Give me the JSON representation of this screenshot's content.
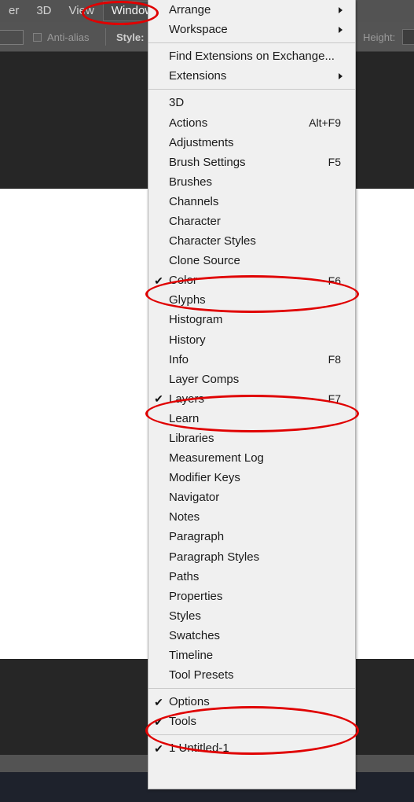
{
  "app": {
    "menubar": [
      {
        "label": "er",
        "active": false
      },
      {
        "label": "3D",
        "active": false
      },
      {
        "label": "View",
        "active": false
      },
      {
        "label": "Window",
        "active": true
      }
    ],
    "options_bar": {
      "antialias_label": "Anti-alias",
      "style_label": "Style:",
      "height_label": "Height:"
    }
  },
  "menu": {
    "title": "Window",
    "groups": [
      {
        "name": "arrange-group",
        "items": [
          {
            "label": "Arrange",
            "shortcut": "",
            "checked": false,
            "submenu": true
          },
          {
            "label": "Workspace",
            "shortcut": "",
            "checked": false,
            "submenu": true
          }
        ]
      },
      {
        "name": "extensions-group",
        "items": [
          {
            "label": "Find Extensions on Exchange...",
            "shortcut": "",
            "checked": false,
            "submenu": false
          },
          {
            "label": "Extensions",
            "shortcut": "",
            "checked": false,
            "submenu": true
          }
        ]
      },
      {
        "name": "panels-group",
        "items": [
          {
            "label": "3D",
            "shortcut": "",
            "checked": false,
            "submenu": false
          },
          {
            "label": "Actions",
            "shortcut": "Alt+F9",
            "checked": false,
            "submenu": false
          },
          {
            "label": "Adjustments",
            "shortcut": "",
            "checked": false,
            "submenu": false
          },
          {
            "label": "Brush Settings",
            "shortcut": "F5",
            "checked": false,
            "submenu": false
          },
          {
            "label": "Brushes",
            "shortcut": "",
            "checked": false,
            "submenu": false
          },
          {
            "label": "Channels",
            "shortcut": "",
            "checked": false,
            "submenu": false
          },
          {
            "label": "Character",
            "shortcut": "",
            "checked": false,
            "submenu": false
          },
          {
            "label": "Character Styles",
            "shortcut": "",
            "checked": false,
            "submenu": false
          },
          {
            "label": "Clone Source",
            "shortcut": "",
            "checked": false,
            "submenu": false
          },
          {
            "label": "Color",
            "shortcut": "F6",
            "checked": true,
            "submenu": false
          },
          {
            "label": "Glyphs",
            "shortcut": "",
            "checked": false,
            "submenu": false
          },
          {
            "label": "Histogram",
            "shortcut": "",
            "checked": false,
            "submenu": false
          },
          {
            "label": "History",
            "shortcut": "",
            "checked": false,
            "submenu": false
          },
          {
            "label": "Info",
            "shortcut": "F8",
            "checked": false,
            "submenu": false
          },
          {
            "label": "Layer Comps",
            "shortcut": "",
            "checked": false,
            "submenu": false
          },
          {
            "label": "Layers",
            "shortcut": "F7",
            "checked": true,
            "submenu": false
          },
          {
            "label": "Learn",
            "shortcut": "",
            "checked": false,
            "submenu": false
          },
          {
            "label": "Libraries",
            "shortcut": "",
            "checked": false,
            "submenu": false
          },
          {
            "label": "Measurement Log",
            "shortcut": "",
            "checked": false,
            "submenu": false
          },
          {
            "label": "Modifier Keys",
            "shortcut": "",
            "checked": false,
            "submenu": false
          },
          {
            "label": "Navigator",
            "shortcut": "",
            "checked": false,
            "submenu": false
          },
          {
            "label": "Notes",
            "shortcut": "",
            "checked": false,
            "submenu": false
          },
          {
            "label": "Paragraph",
            "shortcut": "",
            "checked": false,
            "submenu": false
          },
          {
            "label": "Paragraph Styles",
            "shortcut": "",
            "checked": false,
            "submenu": false
          },
          {
            "label": "Paths",
            "shortcut": "",
            "checked": false,
            "submenu": false
          },
          {
            "label": "Properties",
            "shortcut": "",
            "checked": false,
            "submenu": false
          },
          {
            "label": "Styles",
            "shortcut": "",
            "checked": false,
            "submenu": false
          },
          {
            "label": "Swatches",
            "shortcut": "",
            "checked": false,
            "submenu": false
          },
          {
            "label": "Timeline",
            "shortcut": "",
            "checked": false,
            "submenu": false
          },
          {
            "label": "Tool Presets",
            "shortcut": "",
            "checked": false,
            "submenu": false
          }
        ]
      },
      {
        "name": "ui-group",
        "items": [
          {
            "label": "Options",
            "shortcut": "",
            "checked": true,
            "submenu": false
          },
          {
            "label": "Tools",
            "shortcut": "",
            "checked": true,
            "submenu": false
          }
        ]
      },
      {
        "name": "documents-group",
        "items": [
          {
            "label": "1 Untitled-1",
            "shortcut": "",
            "checked": true,
            "submenu": false
          }
        ]
      }
    ]
  },
  "annotations": {
    "color": "#e00000",
    "shapes": [
      {
        "name": "window-menubar-highlight",
        "target": "Window"
      },
      {
        "name": "color-panel-highlight",
        "target": "Color"
      },
      {
        "name": "layers-panel-highlight",
        "target": "Layers"
      },
      {
        "name": "options-tools-highlight",
        "target": "Options / Tools"
      }
    ]
  },
  "glyphs": {
    "check": "✔"
  }
}
